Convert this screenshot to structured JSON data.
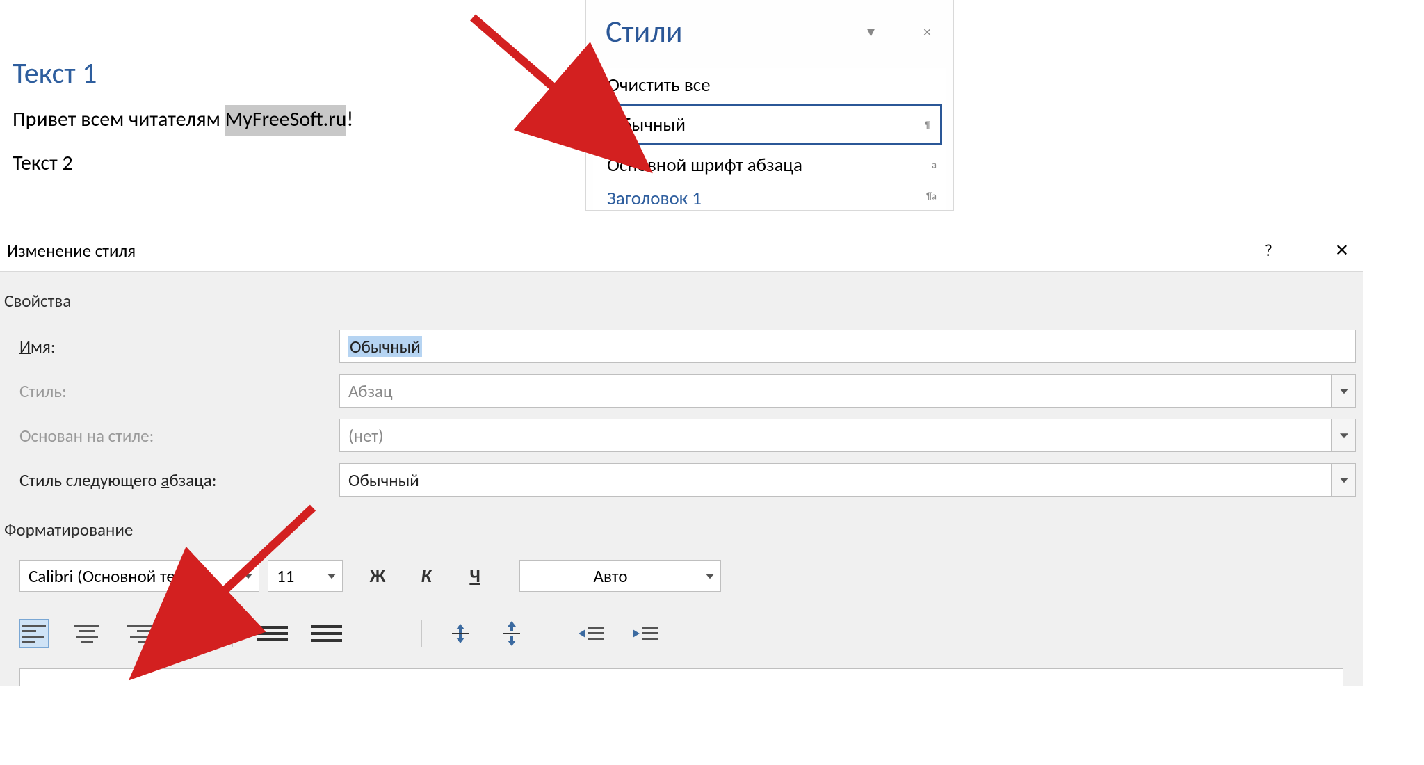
{
  "doc": {
    "heading": "Текст 1",
    "line_prefix": "Привет всем читателям ",
    "line_selected": "MyFreeSoft.ru",
    "line_suffix": "!",
    "heading2": "Текст 2"
  },
  "styles_panel": {
    "title": "Стили",
    "items": [
      {
        "label": "Очистить все",
        "tag": ""
      },
      {
        "label": "Обычный",
        "tag": "¶"
      },
      {
        "label": "Основной шрифт абзаца",
        "tag": "a"
      },
      {
        "label": "Заголовок 1",
        "tag": "¶a"
      }
    ],
    "menu_icon": "▾",
    "close_icon": "×"
  },
  "dialog": {
    "title": "Изменение стиля",
    "help": "?",
    "close": "✕",
    "section_properties": "Свойства",
    "section_formatting": "Форматирование",
    "fields": {
      "name_label_pre": "И",
      "name_label_und": "м",
      "name_label_post": "я:",
      "name_value": "Обычный",
      "styletype_label": "Стиль:",
      "styletype_value": "Абзац",
      "based_label": "Основан на стиле:",
      "based_value": "(нет)",
      "next_label_pre": "Стиль следующего ",
      "next_label_und": "а",
      "next_label_post": "бзаца:",
      "next_value": "Обычный"
    },
    "fmt": {
      "font": "Calibri (Основной текст",
      "size": "11",
      "bold": "Ж",
      "italic": "К",
      "underline": "Ч",
      "color": "Авто"
    }
  }
}
